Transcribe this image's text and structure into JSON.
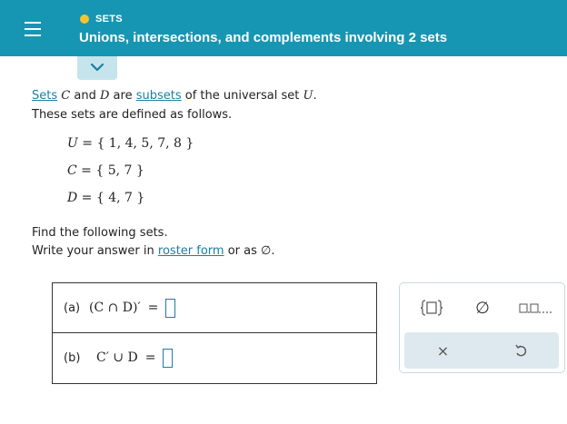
{
  "header": {
    "topic": "SETS",
    "title": "Unions, intersections, and complements involving 2 sets",
    "colors": {
      "bar": "#1696b3",
      "dot": "#f7c22f"
    }
  },
  "problem": {
    "line1": {
      "link1": "Sets",
      "var1": "C",
      "and": "and",
      "var2": "D",
      "are": "are",
      "link2": "subsets",
      "rest": "of the universal set",
      "var3": "U",
      "period": "."
    },
    "line2": "These sets are defined as follows.",
    "definitions": [
      {
        "var": "U",
        "eq": " = ",
        "set": "{ 1, 4, 5, 7, 8 }"
      },
      {
        "var": "C",
        "eq": " = ",
        "set": "{ 5, 7 }"
      },
      {
        "var": "D",
        "eq": " = ",
        "set": "{ 4, 7 }"
      }
    ],
    "line3": "Find the following sets.",
    "line4": {
      "pre": "Write your answer in",
      "link": "roster form",
      "post": "or as",
      "symbol": "∅",
      "end": "."
    }
  },
  "answers": [
    {
      "label": "(a)",
      "expr": "(C ∩ D)′",
      "eq": "="
    },
    {
      "label": "(b)",
      "expr": "C′ ∪ D",
      "eq": "="
    }
  ],
  "keypad": {
    "empty_set": "∅",
    "clear": "×",
    "icons": [
      "braces-box-icon",
      "empty-set-icon",
      "list-boxes-icon",
      "clear-icon",
      "undo-icon"
    ]
  }
}
